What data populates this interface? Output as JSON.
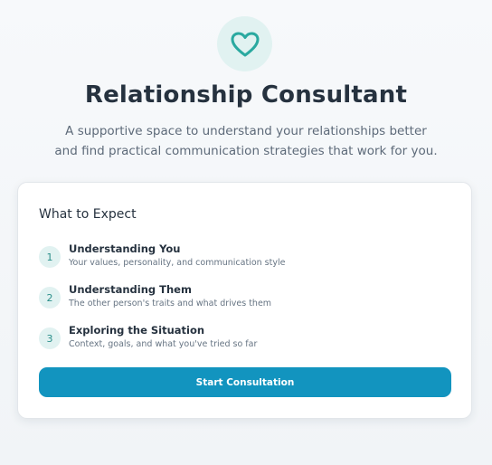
{
  "header": {
    "icon": "heart-icon",
    "title": "Relationship Consultant",
    "subtitle": "A supportive space to understand your relationships better and find practical communication strategies that work for you."
  },
  "card": {
    "title": "What to Expect",
    "steps": [
      {
        "number": "1",
        "title": "Understanding You",
        "description": "Your values, personality, and communication style"
      },
      {
        "number": "2",
        "title": "Understanding Them",
        "description": "The other person's traits and what drives them"
      },
      {
        "number": "3",
        "title": "Exploring the Situation",
        "description": "Context, goals, and what you've tried so far"
      }
    ],
    "button_label": "Start Consultation"
  },
  "colors": {
    "accent": "#1294bf",
    "icon_teal": "#2aa9a0",
    "icon_bg": "#e1f2f1"
  }
}
